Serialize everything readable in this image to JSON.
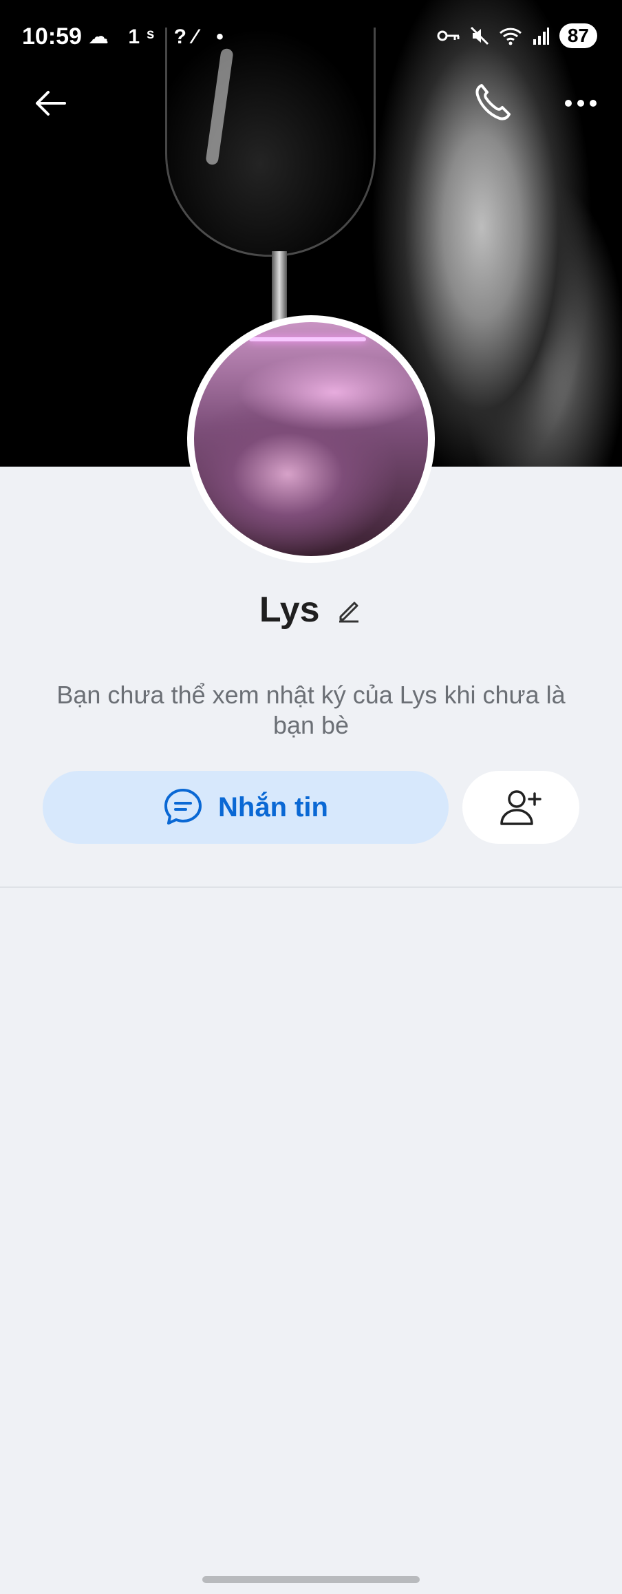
{
  "status_bar": {
    "time": "10:59",
    "left_icons": "☁ 1ˢ ?⁄ •",
    "battery": "87"
  },
  "profile": {
    "name": "Lys",
    "notice": "Bạn chưa thể xem nhật ký của Lys khi chưa là bạn bè"
  },
  "actions": {
    "message_label": "Nhắn tin"
  },
  "colors": {
    "accent": "#0a68d4",
    "message_button_bg": "#d7e8fc",
    "page_bg": "#eff1f5"
  }
}
